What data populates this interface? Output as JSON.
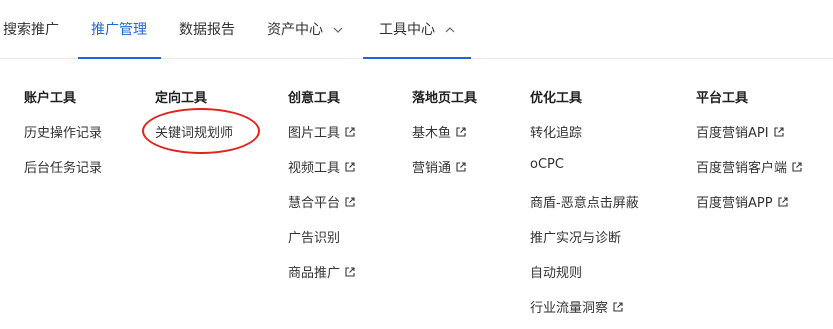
{
  "nav": {
    "tabs": [
      {
        "label": "搜索推广"
      },
      {
        "label": "推广管理"
      },
      {
        "label": "数据报告"
      },
      {
        "label": "资产中心"
      },
      {
        "label": "工具中心"
      }
    ]
  },
  "columns": [
    {
      "title": "账户工具",
      "items": [
        "历史操作记录",
        "后台任务记录"
      ]
    },
    {
      "title": "定向工具",
      "items": [
        "关键词规划师"
      ]
    },
    {
      "title": "创意工具",
      "items": [
        "图片工具",
        "视频工具",
        "慧合平台",
        "广告识别",
        "商品推广"
      ]
    },
    {
      "title": "落地页工具",
      "items": [
        "基木鱼",
        "营销通"
      ]
    },
    {
      "title": "优化工具",
      "items": [
        "转化追踪",
        "oCPC",
        "商盾-恶意点击屏蔽",
        "推广实况与诊断",
        "自动规则",
        "行业流量洞察"
      ]
    },
    {
      "title": "平台工具",
      "items": [
        "百度营销API",
        "百度营销客户端",
        "百度营销APP"
      ]
    }
  ],
  "colors": {
    "accent": "#2066d9",
    "annotation": "#e0231b"
  }
}
